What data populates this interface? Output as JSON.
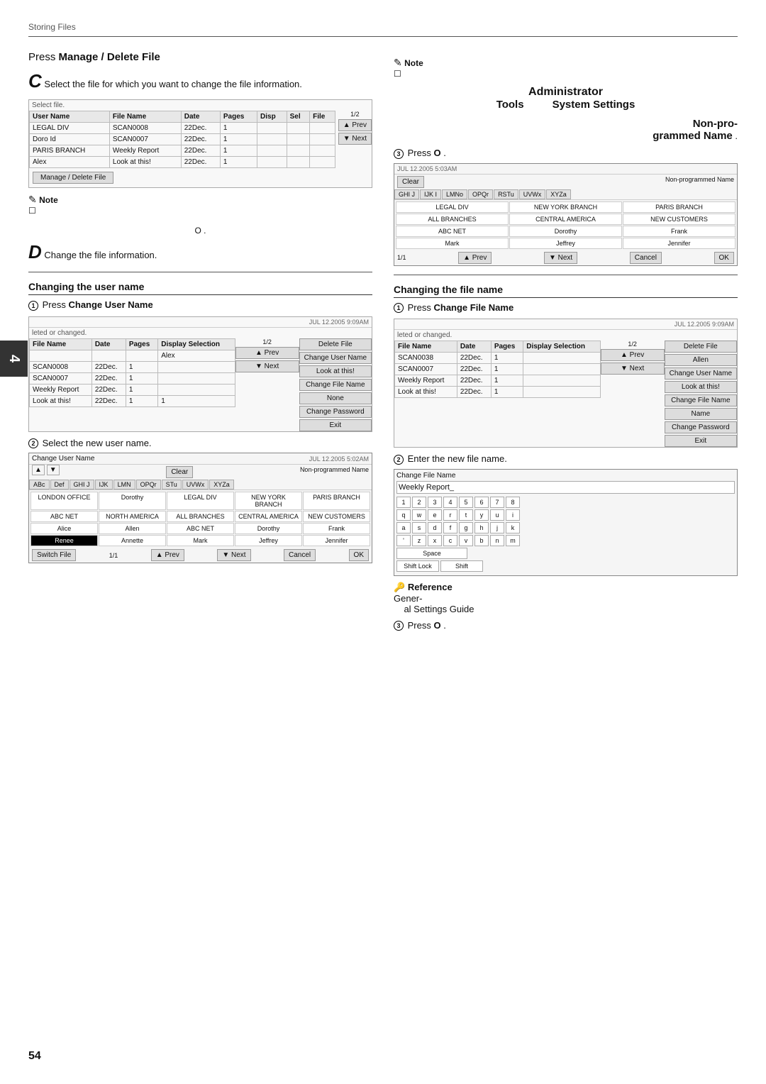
{
  "header": {
    "breadcrumb": "Storing Files"
  },
  "page_number": "54",
  "left": {
    "press_manage": "Press",
    "press_manage_bold": "Manage / Delete File",
    "step_c_letter": "C",
    "step_c_text": "Select the file for which you want to change the file information.",
    "select_file_label": "Select file.",
    "table1": {
      "headers": [
        "User Name",
        "File Name",
        "Date",
        "Pages",
        "Display",
        "Select",
        "File"
      ],
      "rows": [
        [
          "LEGAL DIV",
          "SCAN0008",
          "22Dec.",
          "1",
          "",
          "",
          ""
        ],
        [
          "Doro Id",
          "SCAN0007",
          "22Dec.",
          "1",
          "",
          "",
          ""
        ],
        [
          "PARIS BRANCH",
          "Weekly Report",
          "22Dec.",
          "1",
          "",
          "",
          ""
        ],
        [
          "Alex",
          "Look at this!",
          "22Dec.",
          "1",
          "",
          "",
          ""
        ]
      ],
      "pagination": "1/2",
      "btn_prev": "▲ Prev",
      "btn_next": "▼ Next",
      "btn_manage": "Manage / Delete File"
    },
    "note_label": "Note",
    "note_text": "",
    "circle_o": "O",
    "step_d_letter": "D",
    "step_d_text": "Change the file information.",
    "changing_user_name_title": "Changing the user name",
    "press1_label": "Press",
    "press1_bold": "Change User Name",
    "screen2_timestamp": "JUL  12.2005  9:09AM",
    "screen2_label": "leted or changed.",
    "table2": {
      "headers": [
        "File Name",
        "Date",
        "Pages",
        "Display Selection"
      ],
      "rows": [
        [
          "",
          "",
          "",
          "Alex"
        ],
        [
          "SCAN0008",
          "22Dec.",
          "1",
          ""
        ],
        [
          "SCAN0007",
          "22Dec.",
          "1",
          ""
        ],
        [
          "Weekly Report",
          "22Dec.",
          "1",
          ""
        ],
        [
          "Look at this!",
          "22Dec.",
          "1",
          "1"
        ]
      ],
      "pagination": "1/2",
      "btn_prev": "▲ Prev",
      "btn_next": "▼ Next",
      "btn_delete": "Delete File",
      "btn_change_user": "Change User Name",
      "btn_look": "Look at this!",
      "btn_change_file": "Change File Name",
      "btn_none": "None",
      "btn_change_pass": "Change Password",
      "btn_exit": "Exit"
    },
    "step2_label": "Select the new user name.",
    "user_screen": {
      "title": "Change User Name",
      "timestamp": "JUL  12.2005 5:02AM",
      "clear_btn": "Clear",
      "nonprogrammed": "Non-programmed Name",
      "tabs": [
        "▲",
        "▼",
        "ABc",
        "Def",
        "GHI J",
        "IJK",
        "LMN",
        "OPQr",
        "STu",
        "UVWx",
        "XYZa"
      ],
      "rows": [
        [
          "LONDON OFFICE",
          "Dorothy",
          "LEGAL DIV",
          "NEW YORK BRANCH",
          "PARIS BRANCH"
        ],
        [
          "ABC NET",
          "NORTH AMERICA",
          "ALL BRANCHES",
          "CENTRAL AMERICA",
          "NEW CUSTOMERS"
        ],
        [
          "Alice",
          "Allen",
          "ABC NET",
          "Dorothy",
          "Frank"
        ],
        [
          "Renee",
          "Annette",
          "Mark",
          "Jeffrey",
          "Jennifer"
        ]
      ],
      "pagination": "1/1",
      "btn_prev": "▲ Prev",
      "btn_next": "▼ Next",
      "btn_switch": "Switch File",
      "btn_cancel": "Cancel",
      "btn_ok": "OK"
    }
  },
  "right": {
    "note_label": "Note",
    "note_text": "",
    "admin_title": "Administrator",
    "tools_label": "Tools",
    "system_settings_label": "System Settings",
    "nonpro_title": "Non-pro-\ngrammed Name",
    "step3_press": "Press",
    "step3_circle": "O",
    "user_select_screen": {
      "timestamp": "JUL  12.2005  5:03AM",
      "clear_btn": "Clear",
      "nonprogrammed": "Non-programmed Name",
      "tabs": [
        "GHI J",
        "IJK I",
        "LMNo",
        "OPQr",
        "RSTu",
        "UVWx",
        "XYZa"
      ],
      "rows": [
        [
          "LEGAL DIV",
          "NEW YORK BRANCH",
          "PARIS BRANCH"
        ],
        [
          "ALL BRANCHES",
          "CENTRAL AMERICA",
          "NEW CUSTOMERS"
        ],
        [
          "ABC NET",
          "Dorothy",
          "Frank"
        ],
        [
          "Mark",
          "Jeffrey",
          "Jennifer"
        ]
      ],
      "pagination": "1/1",
      "btn_prev": "▲ Prev",
      "btn_next": "▼ Next",
      "btn_cancel": "Cancel",
      "btn_ok": "OK"
    },
    "changing_file_name_title": "Changing the file name",
    "press_change_file": "Press",
    "press_change_file_bold": "Change File Name",
    "screen3_timestamp": "JUL  12.2005  9:09AM",
    "screen3_label": "leted or changed.",
    "table3": {
      "headers": [
        "File Name",
        "Date",
        "Pages",
        "Display Selection"
      ],
      "rows": [
        [
          "SCAN0038",
          "22Dec.",
          "1",
          ""
        ],
        [
          "SCAN0007",
          "22Dec.",
          "1",
          ""
        ],
        [
          "Weekly Report",
          "22Dec.",
          "1",
          ""
        ],
        [
          "Look at this!",
          "22Dec.",
          "1",
          ""
        ]
      ],
      "pagination": "1/2",
      "btn_prev": "▲ Prev",
      "btn_next": "▼ Next",
      "btn_delete": "Delete File",
      "btn_allen": "Allen",
      "btn_change_user": "Change User Name",
      "btn_look": "Look at this!",
      "btn_change_file": "Change File Name",
      "btn_none": "Name",
      "btn_change_pass": "Change Password",
      "btn_exit": "Exit"
    },
    "step_enter_filename": "Enter the new file name.",
    "change_file_screen": {
      "title": "Change File Name",
      "current_value": "Weekly Report_",
      "kb_rows": [
        [
          "1",
          "2",
          "3",
          "4",
          "5",
          "6",
          "7",
          "8"
        ],
        [
          "q",
          "w",
          "e",
          "r",
          "t",
          "y",
          "u",
          "i"
        ],
        [
          "a",
          "s",
          "d",
          "f",
          "g",
          "h",
          "j",
          "k"
        ],
        [
          "'",
          "z",
          "x",
          "c",
          "v",
          "b",
          "n",
          "m"
        ]
      ],
      "space_btn": "Space",
      "shiftlock_btn": "Shift Lock",
      "shift_btn": "Shift"
    },
    "reference_label": "Reference",
    "reference_text": "General Settings Guide",
    "step3b_press": "Press",
    "step3b_circle": "O"
  }
}
